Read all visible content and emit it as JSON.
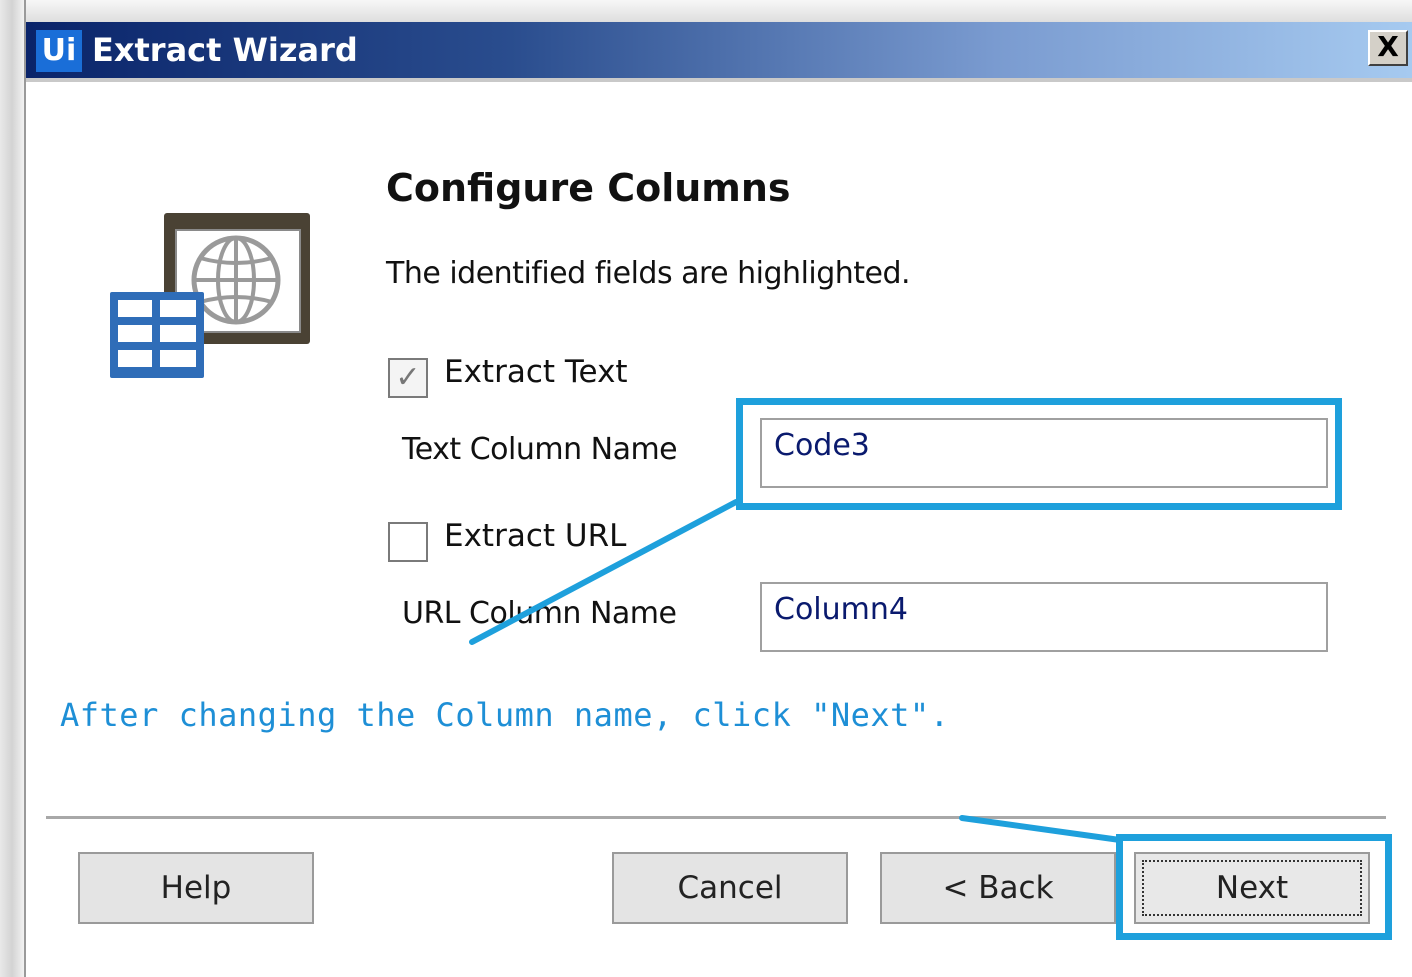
{
  "window": {
    "logo": "Ui",
    "title": "Extract Wizard",
    "close_label": "X"
  },
  "page": {
    "heading": "Configure Columns",
    "subtitle": "The identified fields are highlighted.",
    "icon": "table-web-page-icon"
  },
  "extract_text": {
    "checked": true,
    "check_glyph": "✓",
    "label": "Extract Text",
    "column_label": "Text Column Name",
    "column_value": "Code3"
  },
  "extract_url": {
    "checked": false,
    "label": "Extract URL",
    "column_label": "URL Column Name",
    "column_value": "Column4"
  },
  "annotation": {
    "instruction": "After changing the Column name, click \"Next\".",
    "highlight_color": "#1ea0dc"
  },
  "buttons": {
    "help": "Help",
    "cancel": "Cancel",
    "back": "< Back",
    "next": "Next"
  }
}
